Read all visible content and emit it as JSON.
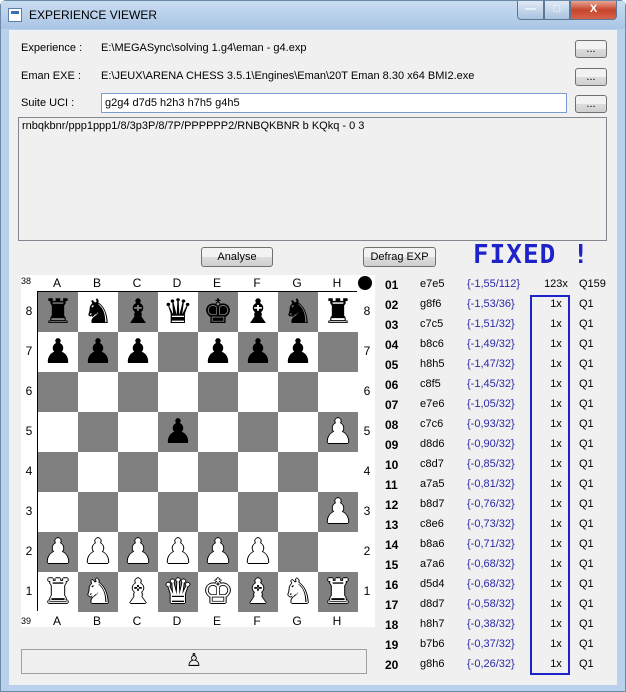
{
  "window": {
    "title": "EXPERIENCE VIEWER",
    "minimize": "—",
    "maximize": "□",
    "close": "X"
  },
  "fields": {
    "experience_label": "Experience :",
    "experience_value": "E:\\MEGASync\\solving 1.g4\\eman - g4.exp",
    "eman_label": "Eman EXE :",
    "eman_value": "E:\\JEUX\\ARENA CHESS 3.5.1\\Engines\\Eman\\20T Eman 8.30 x64 BMI2.exe",
    "uci_label": "Suite UCI :",
    "uci_value": "g2g4 d7d5 h2h3 h7h5 g4h5",
    "browse_label": "...",
    "fen": "rnbqkbnr/ppp1ppp1/8/3p3P/8/7P/PPPPPP2/RNBQKBNR b KQkq - 0 3"
  },
  "buttons": {
    "analyse": "Analyse",
    "defrag": "Defrag EXP"
  },
  "fixed_label": "FIXED !",
  "board": {
    "files": [
      "A",
      "B",
      "C",
      "D",
      "E",
      "F",
      "G",
      "H"
    ],
    "ranks": [
      "8",
      "7",
      "6",
      "5",
      "4",
      "3",
      "2",
      "1"
    ],
    "corner_top": "38",
    "corner_bottom": "39",
    "position": [
      [
        "r",
        "n",
        "b",
        "q",
        "k",
        "b",
        "n",
        "r"
      ],
      [
        "p",
        "p",
        "p",
        "",
        "p",
        "p",
        "p",
        ""
      ],
      [
        "",
        "",
        "",
        "",
        "",
        "",
        "",
        ""
      ],
      [
        "",
        "",
        "",
        "p",
        "",
        "",
        "",
        "P"
      ],
      [
        "",
        "",
        "",
        "",
        "",
        "",
        "",
        ""
      ],
      [
        "",
        "",
        "",
        "",
        "",
        "",
        "",
        "P"
      ],
      [
        "P",
        "P",
        "P",
        "P",
        "P",
        "P",
        "",
        ""
      ],
      [
        "R",
        "N",
        "B",
        "Q",
        "K",
        "B",
        "N",
        "R"
      ]
    ]
  },
  "moves": [
    {
      "idx": "01",
      "move": "e7e5",
      "eval": "{-1,55/112}",
      "count": "123x",
      "q": "Q159"
    },
    {
      "idx": "02",
      "move": "g8f6",
      "eval": "{-1,53/36}",
      "count": "1x",
      "q": "Q1"
    },
    {
      "idx": "03",
      "move": "c7c5",
      "eval": "{-1,51/32}",
      "count": "1x",
      "q": "Q1"
    },
    {
      "idx": "04",
      "move": "b8c6",
      "eval": "{-1,49/32}",
      "count": "1x",
      "q": "Q1"
    },
    {
      "idx": "05",
      "move": "h8h5",
      "eval": "{-1,47/32}",
      "count": "1x",
      "q": "Q1"
    },
    {
      "idx": "06",
      "move": "c8f5",
      "eval": "{-1,45/32}",
      "count": "1x",
      "q": "Q1"
    },
    {
      "idx": "07",
      "move": "e7e6",
      "eval": "{-1,05/32}",
      "count": "1x",
      "q": "Q1"
    },
    {
      "idx": "08",
      "move": "c7c6",
      "eval": "{-0,93/32}",
      "count": "1x",
      "q": "Q1"
    },
    {
      "idx": "09",
      "move": "d8d6",
      "eval": "{-0,90/32}",
      "count": "1x",
      "q": "Q1"
    },
    {
      "idx": "10",
      "move": "c8d7",
      "eval": "{-0,85/32}",
      "count": "1x",
      "q": "Q1"
    },
    {
      "idx": "11",
      "move": "a7a5",
      "eval": "{-0,81/32}",
      "count": "1x",
      "q": "Q1"
    },
    {
      "idx": "12",
      "move": "b8d7",
      "eval": "{-0,76/32}",
      "count": "1x",
      "q": "Q1"
    },
    {
      "idx": "13",
      "move": "c8e6",
      "eval": "{-0,73/32}",
      "count": "1x",
      "q": "Q1"
    },
    {
      "idx": "14",
      "move": "b8a6",
      "eval": "{-0,71/32}",
      "count": "1x",
      "q": "Q1"
    },
    {
      "idx": "15",
      "move": "a7a6",
      "eval": "{-0,68/32}",
      "count": "1x",
      "q": "Q1"
    },
    {
      "idx": "16",
      "move": "d5d4",
      "eval": "{-0,68/32}",
      "count": "1x",
      "q": "Q1"
    },
    {
      "idx": "17",
      "move": "d8d7",
      "eval": "{-0,58/32}",
      "count": "1x",
      "q": "Q1"
    },
    {
      "idx": "18",
      "move": "h8h7",
      "eval": "{-0,38/32}",
      "count": "1x",
      "q": "Q1"
    },
    {
      "idx": "19",
      "move": "b7b6",
      "eval": "{-0,37/32}",
      "count": "1x",
      "q": "Q1"
    },
    {
      "idx": "20",
      "move": "g8h6",
      "eval": "{-0,26/32}",
      "count": "1x",
      "q": "Q1"
    }
  ],
  "status_piece": "♙"
}
